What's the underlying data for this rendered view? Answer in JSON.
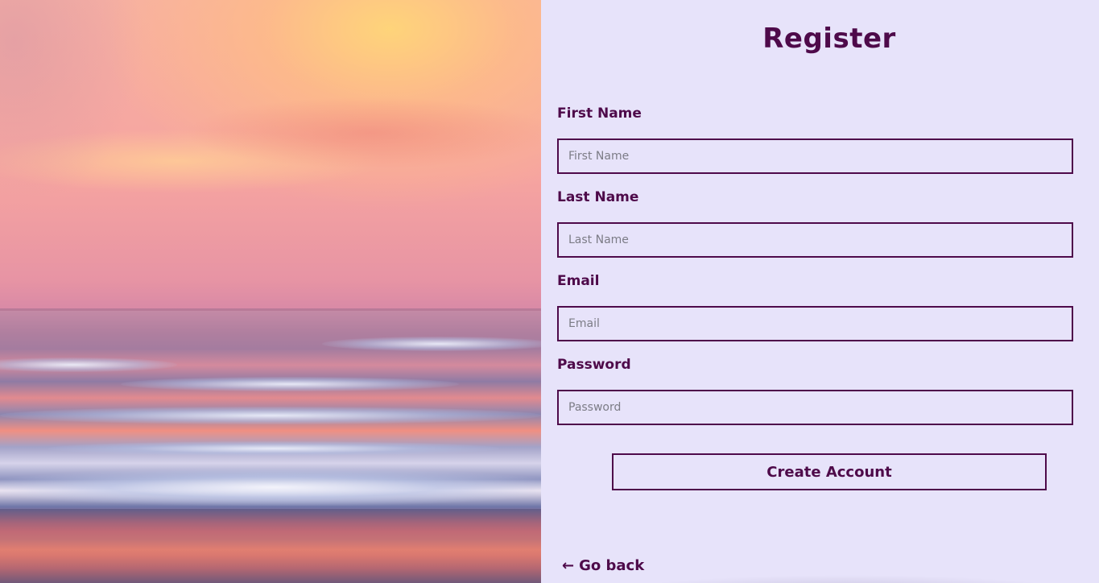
{
  "hero": {
    "icon": "sunset-ocean-image"
  },
  "form": {
    "title": "Register",
    "fields": [
      {
        "label": "First Name",
        "placeholder": "First Name",
        "value": ""
      },
      {
        "label": "Last Name",
        "placeholder": "Last Name",
        "value": ""
      },
      {
        "label": "Email",
        "placeholder": "Email",
        "value": ""
      },
      {
        "label": "Password",
        "placeholder": "Password",
        "value": ""
      }
    ],
    "submit_label": "Create Account",
    "back_arrow": "←",
    "back_label": "Go back"
  },
  "colors": {
    "accent": "#4e0a4a",
    "panel_background": "#e7e3fa",
    "placeholder": "#7c7c86"
  }
}
